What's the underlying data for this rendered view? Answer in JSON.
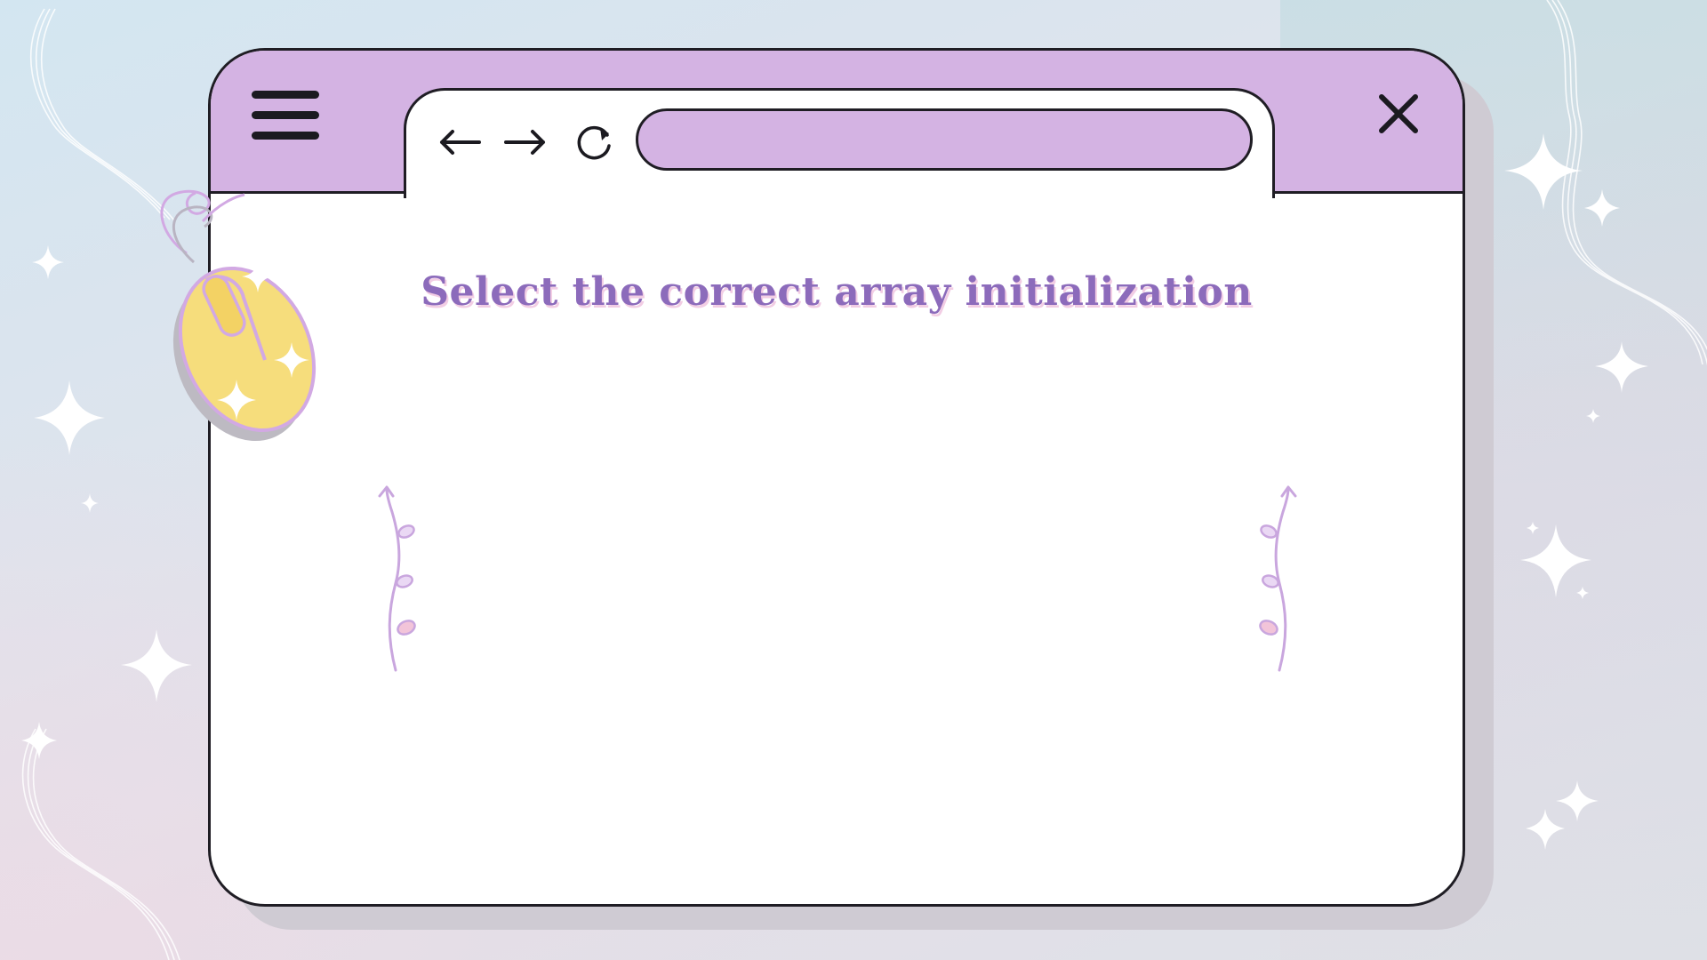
{
  "titlebar": {
    "menu_icon": "hamburger-menu-icon",
    "close_icon": "close-x-icon"
  },
  "tab": {
    "back_icon": "arrow-left-icon",
    "forward_icon": "arrow-right-icon",
    "reload_icon": "reload-icon",
    "address_value": ""
  },
  "main": {
    "heading": "Select the correct array initialization"
  },
  "colors": {
    "window_accent": "#d4b3e3",
    "heading_text": "#8c6bbb",
    "heading_shadow": "#f2cde4",
    "outline": "#1f1d24",
    "mouse_body": "#f6dd7c",
    "vine": "#c9a6de",
    "sparkle": "#ffffff"
  }
}
